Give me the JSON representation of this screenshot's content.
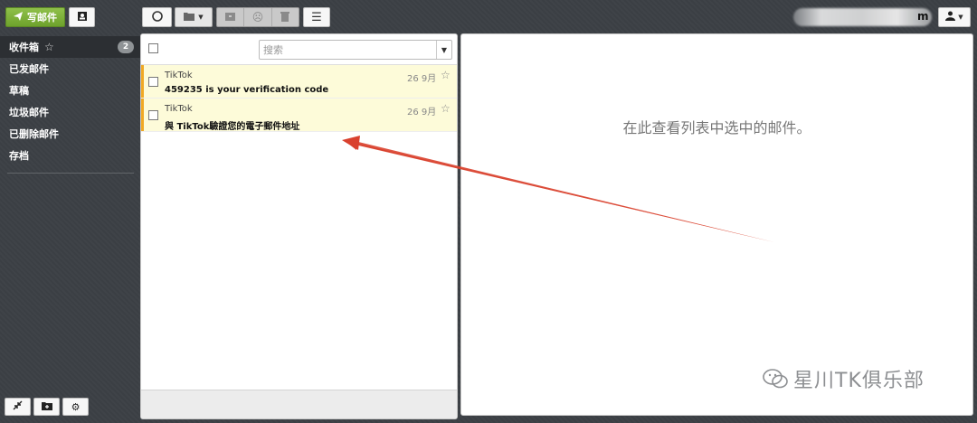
{
  "toolbar": {
    "compose_label": "写邮件",
    "account_suffix": "m"
  },
  "sidebar": {
    "items": [
      {
        "label": "收件箱",
        "badge": "2"
      },
      {
        "label": "已发邮件"
      },
      {
        "label": "草稿"
      },
      {
        "label": "垃圾邮件"
      },
      {
        "label": "已删除邮件"
      },
      {
        "label": "存档"
      }
    ]
  },
  "list": {
    "search_placeholder": "搜索",
    "messages": [
      {
        "sender": "TikTok",
        "subject": "459235 is your verification code",
        "date": "26 9月"
      },
      {
        "sender": "TikTok",
        "subject": "與 TikTok驗證您的電子郵件地址",
        "date": "26 9月"
      }
    ]
  },
  "reading_pane": {
    "empty_text": "在此查看列表中选中的邮件。"
  },
  "watermark": {
    "text": "星川TK俱乐部"
  },
  "colors": {
    "accent_green": "#7ab236",
    "unread_bar": "#f0a824",
    "unread_bg": "#fdfbd9",
    "annotation_red": "#d9412e"
  }
}
